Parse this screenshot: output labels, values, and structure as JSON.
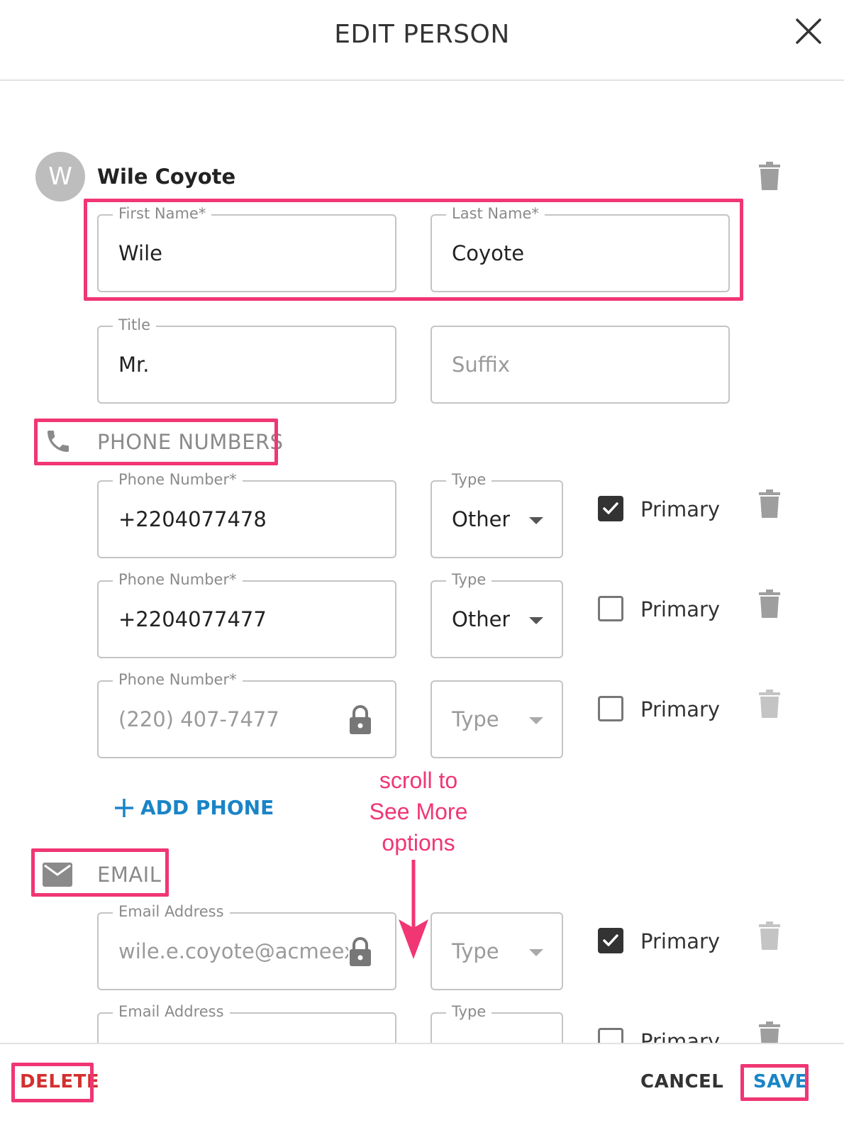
{
  "header": {
    "title": "EDIT PERSON",
    "close_icon": "close-icon"
  },
  "person": {
    "avatar_initial": "W",
    "display_name": "Wile Coyote"
  },
  "name_fields": {
    "first_name": {
      "label": "First Name",
      "required_mark": "*",
      "value": "Wile"
    },
    "last_name": {
      "label": "Last Name",
      "required_mark": "*",
      "value": "Coyote"
    },
    "title": {
      "label": "Title",
      "value": "Mr."
    },
    "suffix": {
      "placeholder": "Suffix"
    }
  },
  "phones": {
    "section_label": "PHONE NUMBERS",
    "icon": "phone-icon",
    "rows": [
      {
        "label": "Phone Number",
        "required_mark": "*",
        "value": "+2204077478",
        "type_label": "Type",
        "type_value": "Other",
        "primary_label": "Primary",
        "primary": true,
        "locked": false
      },
      {
        "label": "Phone Number",
        "required_mark": "*",
        "value": "+2204077477",
        "type_label": "Type",
        "type_value": "Other",
        "primary_label": "Primary",
        "primary": false,
        "locked": false
      },
      {
        "label": "Phone Number",
        "required_mark": "*",
        "value": "(220) 407-7477",
        "type_placeholder": "Type",
        "primary_label": "Primary",
        "primary": false,
        "locked": true
      }
    ],
    "add_label": "ADD PHONE"
  },
  "email": {
    "section_label": "EMAIL",
    "icon": "mail-icon",
    "rows": [
      {
        "label": "Email Address",
        "value": "wile.e.coyote@acmeexpl",
        "type_placeholder": "Type",
        "primary_label": "Primary",
        "primary": true,
        "locked": true
      },
      {
        "label": "Email Address",
        "type_label": "Type",
        "primary_label": "Primary",
        "primary": false
      }
    ]
  },
  "annotation": {
    "line1": "scroll to",
    "line2": "See More",
    "line3": "options",
    "color": "#f03673"
  },
  "footer": {
    "delete_label": "DELETE",
    "cancel_label": "CANCEL",
    "save_label": "SAVE",
    "delete_color": "#d32f2f",
    "save_color": "#1a84c7"
  }
}
